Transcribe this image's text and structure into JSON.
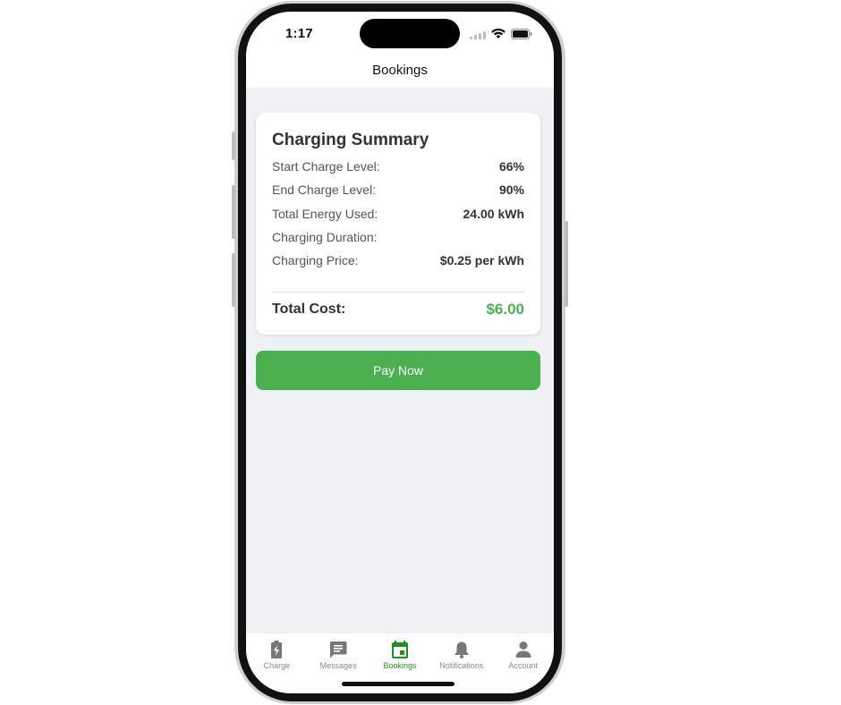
{
  "status_bar": {
    "time": "1:17"
  },
  "header": {
    "title": "Bookings"
  },
  "summary": {
    "title": "Charging Summary",
    "rows": [
      {
        "label": "Start Charge Level:",
        "value": "66%"
      },
      {
        "label": "End Charge Level:",
        "value": "90%"
      },
      {
        "label": "Total Energy Used:",
        "value": "24.00 kWh"
      },
      {
        "label": "Charging Duration:",
        "value": ""
      },
      {
        "label": "Charging Price:",
        "value": "$0.25 per kWh"
      }
    ],
    "total_label": "Total Cost:",
    "total_value": "$6.00"
  },
  "pay_button": {
    "label": "Pay Now"
  },
  "tabs": [
    {
      "label": "Charge",
      "icon": "battery-charging-icon",
      "active": false
    },
    {
      "label": "Messages",
      "icon": "message-icon",
      "active": false
    },
    {
      "label": "Bookings",
      "icon": "calendar-icon",
      "active": true
    },
    {
      "label": "Notifications",
      "icon": "bell-icon",
      "active": false
    },
    {
      "label": "Account",
      "icon": "person-icon",
      "active": false
    }
  ],
  "colors": {
    "accent": "#4caf50",
    "active_tab": "#1e8e1e",
    "background": "#eef2f5"
  }
}
